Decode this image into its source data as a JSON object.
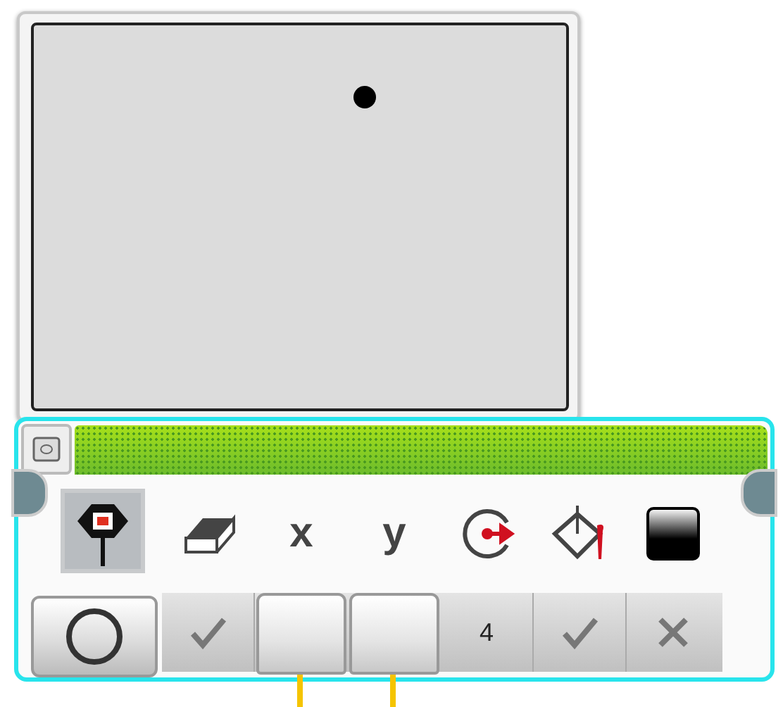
{
  "mode": {
    "selected": true
  },
  "shape_mode": {
    "kind": "circle"
  },
  "params": [
    {
      "kind": "bool",
      "value": true
    },
    {
      "kind": "wired",
      "label": "x"
    },
    {
      "kind": "wired",
      "label": "y"
    },
    {
      "kind": "number",
      "value": "4"
    },
    {
      "kind": "bool",
      "value": true
    },
    {
      "kind": "bool",
      "value": false
    }
  ]
}
